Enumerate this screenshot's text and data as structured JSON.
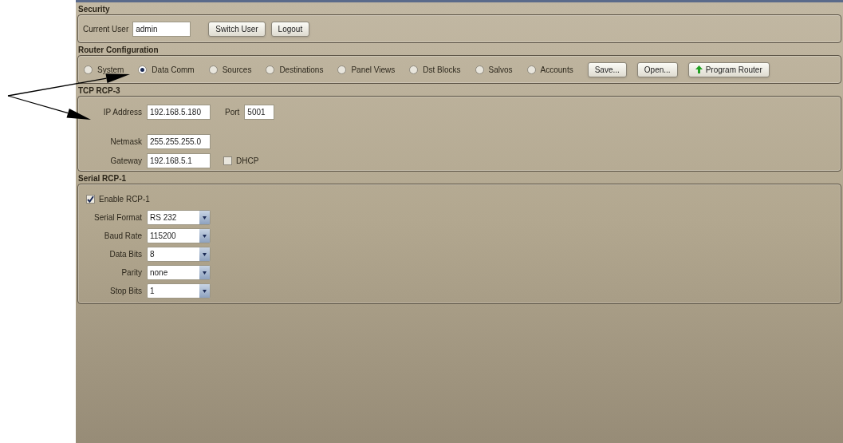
{
  "security": {
    "title": "Security",
    "current_user_label": "Current User",
    "current_user": "admin",
    "buttons": [
      "Switch User",
      "Logout"
    ]
  },
  "router_configuration": {
    "title": "Router Configuration",
    "views": [
      {
        "label": "System",
        "selected": false
      },
      {
        "label": "Data Comm",
        "selected": true
      },
      {
        "label": "Sources",
        "selected": false
      },
      {
        "label": "Destinations",
        "selected": false
      },
      {
        "label": "Panel Views",
        "selected": false
      },
      {
        "label": "Dst Blocks",
        "selected": false
      },
      {
        "label": "Salvos",
        "selected": false
      },
      {
        "label": "Accounts",
        "selected": false
      }
    ],
    "buttons": [
      {
        "label": "Save...",
        "kind": "plain"
      },
      {
        "label": "Open...",
        "kind": "plain"
      },
      {
        "label": "Program Router",
        "kind": "upload"
      }
    ]
  },
  "tcp": {
    "title": "TCP RCP-3",
    "ip_label": "IP Address",
    "ip": "192.168.5.180",
    "port_label": "Port",
    "port": "5001",
    "netmask_label": "Netmask",
    "netmask": "255.255.255.0",
    "gateway_label": "Gateway",
    "gateway": "192.168.5.1",
    "dhcp": {
      "label": "DHCP",
      "checked": false
    }
  },
  "serial": {
    "title": "Serial RCP-1",
    "enable": {
      "label": "Enable RCP-1",
      "checked": true
    },
    "settings": [
      {
        "label": "Serial Format",
        "value": "RS 232"
      },
      {
        "label": "Baud Rate",
        "value": "115200"
      },
      {
        "label": "Data Bits",
        "value": "8"
      },
      {
        "label": "Parity",
        "value": "none"
      },
      {
        "label": "Stop Bits",
        "value": "1"
      }
    ]
  }
}
